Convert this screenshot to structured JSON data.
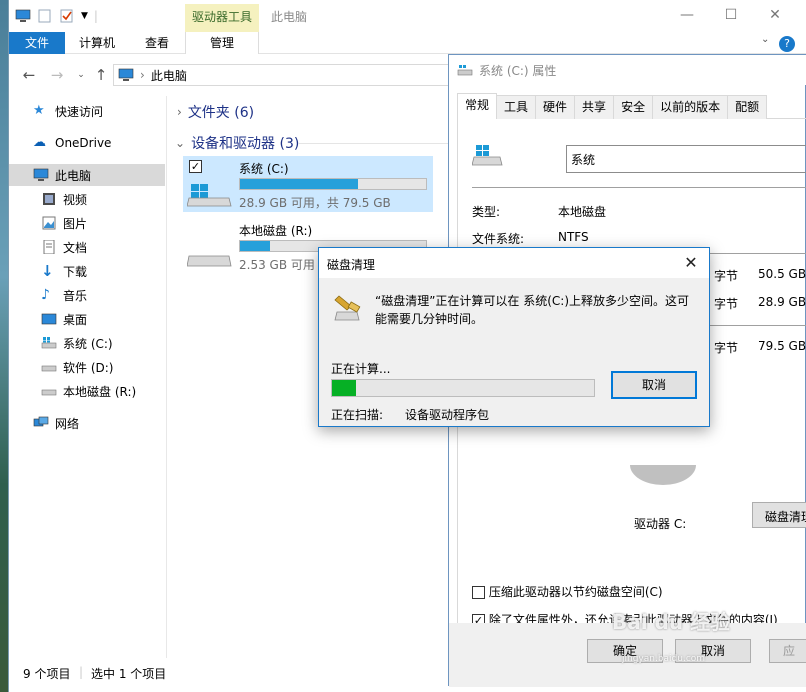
{
  "explorer": {
    "title": "此电脑",
    "context_tab_group": "驱动器工具",
    "tabs": {
      "file": "文件",
      "computer": "计算机",
      "view": "查看",
      "manage": "管理"
    },
    "help": "?",
    "address": {
      "location": "此电脑"
    },
    "sidebar": {
      "items": [
        {
          "label": "快速访问",
          "icon": "star-icon"
        },
        {
          "label": "OneDrive",
          "icon": "cloud-icon"
        },
        {
          "label": "此电脑",
          "icon": "computer-icon",
          "selected": true
        },
        {
          "label": "视频",
          "icon": "video-icon"
        },
        {
          "label": "图片",
          "icon": "picture-icon"
        },
        {
          "label": "文档",
          "icon": "document-icon"
        },
        {
          "label": "下载",
          "icon": "download-icon"
        },
        {
          "label": "音乐",
          "icon": "music-icon"
        },
        {
          "label": "桌面",
          "icon": "desktop-icon"
        },
        {
          "label": "系统 (C:)",
          "icon": "drive-icon"
        },
        {
          "label": "软件 (D:)",
          "icon": "drive-icon"
        },
        {
          "label": "本地磁盘 (R:)",
          "icon": "drive-icon"
        },
        {
          "label": "网络",
          "icon": "network-icon"
        }
      ]
    },
    "groups": {
      "folders": "文件夹 (6)",
      "devices": "设备和驱动器 (3)"
    },
    "drives": [
      {
        "name": "系统 (C:)",
        "info": "28.9 GB 可用，共 79.5 GB",
        "used_fraction": 0.636,
        "selected": true
      },
      {
        "name": "本地磁盘 (R:)",
        "info": "2.53 GB 可用",
        "used_fraction": 0.16
      }
    ],
    "status": {
      "count": "9 个项目",
      "selected": "选中 1 个项目"
    }
  },
  "properties": {
    "title": "系统 (C:) 属性",
    "tabs": [
      "常规",
      "工具",
      "硬件",
      "共享",
      "安全",
      "以前的版本",
      "配额"
    ],
    "name_value": "系统",
    "type_label": "类型:",
    "type_value": "本地磁盘",
    "fs_label": "文件系统:",
    "fs_value": "NTFS",
    "rows": [
      {
        "unit": "字节",
        "value": "50.5 GB"
      },
      {
        "unit": "字节",
        "value": "28.9 GB"
      },
      {
        "unit": "字节",
        "value": "79.5 GB"
      }
    ],
    "drive_label": "驱动器 C:",
    "cleanup_button": "磁盘清理",
    "compress_label": "压缩此驱动器以节约磁盘空间(C)",
    "index_label": "除了文件属性外，还允许索引此驱动器上文件的内容(I)",
    "ok": "确定",
    "cancel": "取消",
    "apply": "应"
  },
  "cleanup": {
    "title": "磁盘清理",
    "message": "“磁盘清理”正在计算可以在 系统(C:)上释放多少空间。这可能需要几分钟时间。",
    "calculating": "正在计算...",
    "progress": 0.09,
    "cancel": "取消",
    "scanning_label": "正在扫描:",
    "scanning_value": "设备驱动程序包"
  },
  "watermark": {
    "brand": "Bai du 经验",
    "url": "jingyan.baidu.com"
  },
  "colors": {
    "accent": "#1979ca",
    "progress": "#06b025",
    "drive_bar": "#26a0da"
  }
}
